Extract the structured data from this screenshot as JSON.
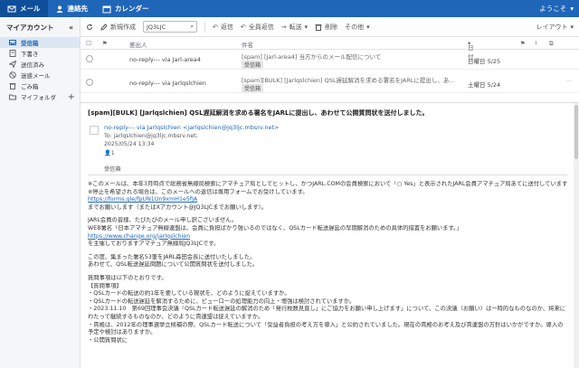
{
  "topbar": {
    "tabs": [
      {
        "label": "メール",
        "icon": "mail-icon"
      },
      {
        "label": "連絡先",
        "icon": "contacts-icon"
      },
      {
        "label": "カレンダー",
        "icon": "calendar-icon"
      }
    ],
    "welcome": "ようこそ"
  },
  "sidebar": {
    "title": "マイアカウント",
    "items": [
      {
        "label": "受信箱",
        "icon": "inbox-icon"
      },
      {
        "label": "下書き",
        "icon": "drafts-icon"
      },
      {
        "label": "送信済み",
        "icon": "sent-icon"
      },
      {
        "label": "迷惑メール",
        "icon": "spam-icon"
      },
      {
        "label": "ごみ箱",
        "icon": "trash-icon"
      },
      {
        "label": "マイフォルダ",
        "icon": "folder-icon"
      }
    ]
  },
  "toolbar": {
    "compose": "新規作成",
    "search_value": "JQ3LJC",
    "reply": "返信",
    "reply_all": "全員返信",
    "forward": "転送",
    "delete": "削除",
    "other": "その他",
    "layout": "レイアウト"
  },
  "list": {
    "headers": {
      "sender": "差出人",
      "subject": "件名",
      "date": "日付"
    },
    "rows": [
      {
        "from": "no-reply--- via Jarl-area4",
        "subject": "[spam] [Jarl-area4] 当方からのメール配信について",
        "badge": "受信箱",
        "date": "日曜日 5/25"
      },
      {
        "from": "no-reply--- via Jarlqslchien",
        "subject": "[spam][BULK] [Jarlqslchien] QSL遅延解消を求める署名をJARLに提出し、あわせて公...",
        "badge": "受信箱",
        "date": "土曜日 5/24"
      }
    ]
  },
  "message": {
    "title": "[spam][BULK] [Jarlqslchien] QSL遅延解消を求める署名をJARLに提出し、あわせて公開質問状を送付しました。",
    "from": "no-reply--- via Jarlqslchien <jarlqslchien@jq3ljc.mbsrv.net>",
    "to": "To: jarlqslchien@jq3ljc.mbsrv.net;",
    "datetime": "2025/05/24 13:34",
    "count": "1",
    "folder": "受信箱",
    "body": [
      "※このメールは、本年3月時点で総務省無線局検索にアマチュア局としてヒットし、かつJARL.COMの会員検索において「○ Yes」と表示されたJARL会員アマチュア局あてに送付しています。",
      "※停止を希望される場合は、このメールへの返信は専用フォームでお受けしています。",
      "https://forms.gle/fpUN1Un9xmH1e5fJA",
      "までお願いします（またはXアカウント@JQ3LJCまでお願いします）。",
      "",
      "JARL会員の皆様、たびたびのメール申し訳ございません。",
      "WEB署名「日本アマチュア無線連盟は、会員に負担ばかり強いるのではなく、QSLカード転送遅延の早期解消のための具体的措置をお願います。」",
      "https://www.change.org/jarlqslchien",
      "を主催しておりますアマチュア無線局JQ3LJCです。",
      "",
      "この度、集まった署名53筆をJARL森田会長に送付いたしました。",
      "あわせて、QSL転送遅延問題について公開質問状を送付しました。",
      "",
      "質問事項は以下のとおりです。",
      "【質問事項】",
      "・QSLカードの転送の約1年を要している現状を、どのように捉えていますか。",
      "・QSLカードの転送遅延を解消するために、ビューローの処理能力の向上・増強は検討されていますか。",
      "・2023.11.10　第69回理事会決議「QSLカード転送遅延の解消のため「発行枚数見直し」にご協力をお願い申し上げます」について、この決議（お願い）は一時的なものなのか、将来にわたって継続するものなのか、どのように貴連盟は捉えていますか。",
      "・貴殿は、2012年の理事選挙立候補の際、QSLカード転送について「受益者負担の考え方を導入」と公約されていました。現在の貴殿のお考え及び貴連盟の方針はいかがですか。導入の予定や検討はありますか。",
      "・公開質問状に"
    ]
  }
}
